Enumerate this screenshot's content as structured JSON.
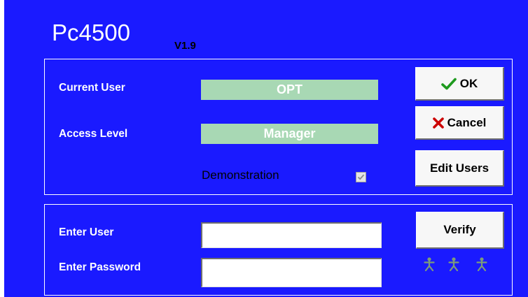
{
  "app": {
    "title": "Pc4500",
    "version": "V1.9"
  },
  "status": {
    "current_user_label": "Current User",
    "current_user_value": "OPT",
    "access_level_label": "Access Level",
    "access_level_value": "Manager",
    "demonstration_label": "Demonstration",
    "demonstration_checked": true
  },
  "buttons": {
    "ok": "OK",
    "cancel": "Cancel",
    "edit_users": "Edit Users",
    "verify": "Verify"
  },
  "login": {
    "user_label": "Enter User",
    "user_value": "",
    "password_label": "Enter Password",
    "password_value": ""
  },
  "colors": {
    "background": "#1a1aff",
    "value_box": "#a8d8b4",
    "ok_check": "#1e9a1e",
    "cancel_x": "#cc0000",
    "person_icons": "#7c9c7a"
  },
  "icons": [
    "check-icon",
    "x-icon",
    "checkbox-check-icon",
    "person-icon"
  ]
}
